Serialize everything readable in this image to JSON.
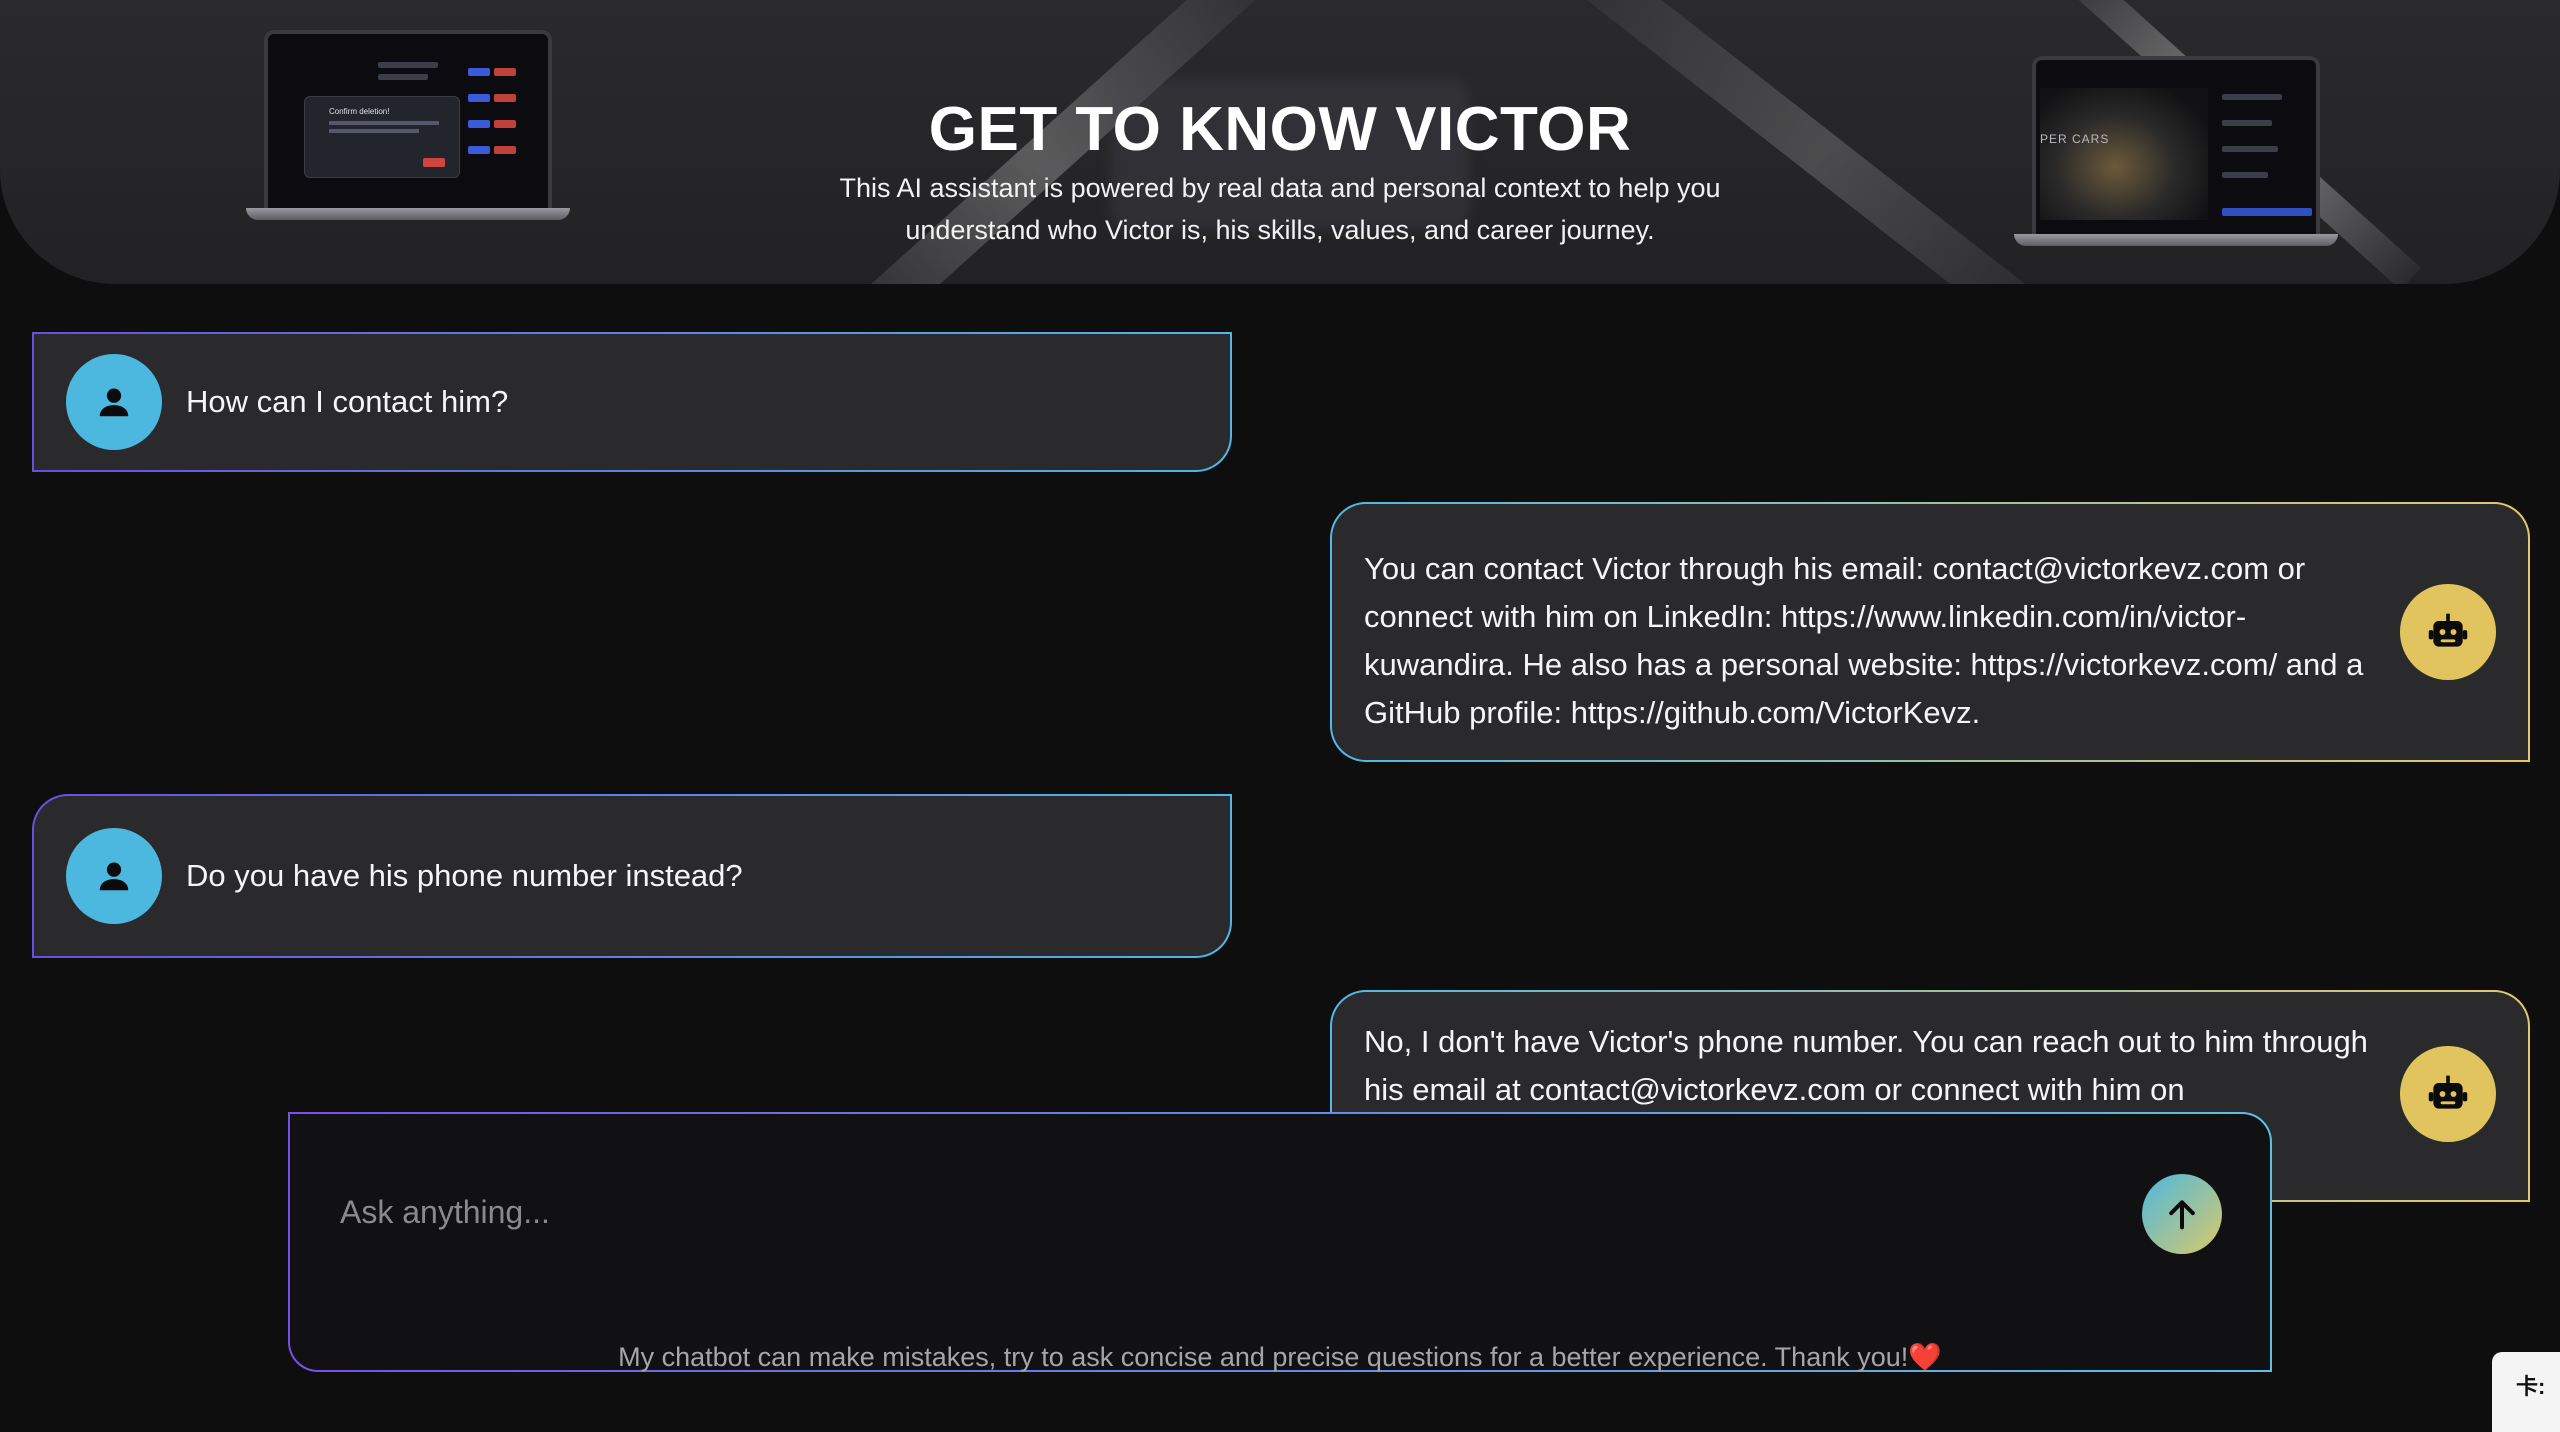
{
  "hero": {
    "title": "GET TO KNOW VICTOR",
    "subtitle": "This AI assistant is powered by real data and personal context to help you understand who Victor is, his skills, values, and career journey.",
    "left_laptop": {
      "modal_title": "Confirm deletion!"
    },
    "right_laptop": {
      "label": "PER CARS"
    }
  },
  "messages": [
    {
      "role": "user",
      "text": "How can I contact him?"
    },
    {
      "role": "bot",
      "text": "You can contact Victor through his email: contact@victorkevz.com or connect with him on LinkedIn: https://www.linkedin.com/in/victor-kuwandira. He also has a personal website: https://victorkevz.com/ and a GitHub profile: https://github.com/VictorKevz."
    },
    {
      "role": "user",
      "text": "Do you have his phone number instead?"
    },
    {
      "role": "bot",
      "text": "No, I don't have Victor's phone number. You can reach out to him through his email at contact@victorkevz.com or connect with him on"
    }
  ],
  "composer": {
    "placeholder": "Ask anything...",
    "send_icon": "arrow-up-icon",
    "disclaimer": "My chatbot can make mistakes, try to ask concise and precise questions for a better experience. Thank you!❤️"
  },
  "corner_tab": {
    "text": "卡:"
  },
  "colors": {
    "user_avatar": "#4db8df",
    "bot_avatar": "#e1c45e",
    "background": "#0e0e0f"
  }
}
